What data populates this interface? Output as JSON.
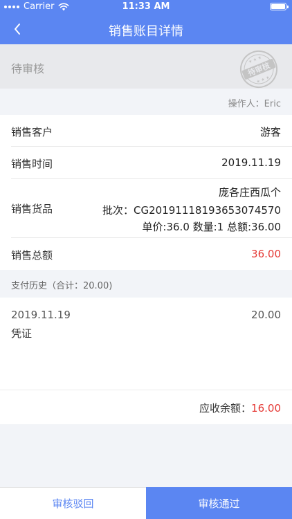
{
  "status_bar": {
    "carrier": "Carrier",
    "time": "11:33 AM",
    "battery_level": 1.0
  },
  "nav": {
    "title": "销售账目详情",
    "back_icon": "chevron-left-icon"
  },
  "status": {
    "label": "待审核",
    "stamp_text": "待审核"
  },
  "operator": {
    "label": "操作人",
    "separator": "：",
    "name": "Eric"
  },
  "details": {
    "customer_label": "销售客户",
    "customer_value": "游客",
    "time_label": "销售时间",
    "time_value": "2019.11.19",
    "goods_label": "销售货品",
    "goods_name": "庞各庄西瓜个",
    "goods_batch": "批次：CG20191118193653074570",
    "goods_price": "单价:36.0 数量:1 总额:36.00",
    "total_label": "销售总额",
    "total_value": "36.00"
  },
  "payment_history": {
    "title": "支付历史（合计：20.00)",
    "items": [
      {
        "date": "2019.11.19",
        "amount": "20.00",
        "voucher_label": "凭证"
      }
    ]
  },
  "receivable": {
    "label": "应收余额：",
    "value": "16.00"
  },
  "actions": {
    "reject_label": "审核驳回",
    "approve_label": "审核通过"
  },
  "colors": {
    "primary": "#5b86f2",
    "amount_red": "#e53935",
    "stamp_gray": "#c4c4c4"
  }
}
